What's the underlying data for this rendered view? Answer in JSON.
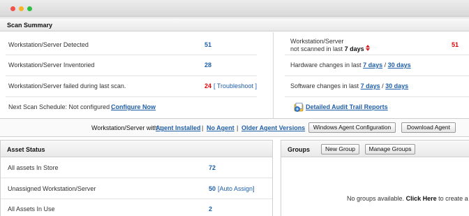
{
  "scan_summary": {
    "title": "Scan Summary",
    "left_rows": [
      {
        "label": "Workstation/Server Detected",
        "value": "51"
      },
      {
        "label": "Workstation/Server Inventoried",
        "value": "28"
      },
      {
        "label": "Workstation/Server failed during last scan.",
        "value": "24",
        "action": "[ Troubleshoot ]"
      }
    ],
    "schedule_label": "Next Scan Schedule: Not configured ,",
    "schedule_link": "Configure Now",
    "not_scanned_line1": "Workstation/Server",
    "not_scanned_line2": "not scanned in last",
    "not_scanned_period": "7 days",
    "not_scanned_value": "51",
    "hardware_label": "Hardware changes in last",
    "software_label": "Software changes in last",
    "period_7": "7 days",
    "separator": "/",
    "period_30": "30 days",
    "audit_link": "Detailed Audit Trail Reports",
    "icons": [
      "sort-arrows-icon",
      "report-icon"
    ]
  },
  "agent_bar": {
    "prefix": "Workstation/Server with :",
    "links": [
      "Agent Installed",
      "No Agent",
      "Older Agent Versions"
    ],
    "separator": "|",
    "config_button": "Windows Agent Configuration",
    "download_button": "Download Agent"
  },
  "asset_status": {
    "title": "Asset Status",
    "rows": [
      {
        "label": "All assets In Store",
        "value": "72"
      },
      {
        "label": "Unassigned Workstation/Server",
        "value": "50",
        "action": "[Auto Assign]"
      },
      {
        "label": "All Assets In Use",
        "value": "2"
      }
    ]
  },
  "groups": {
    "title": "Groups",
    "new_button": "New Group",
    "manage_button": "Manage Groups",
    "empty_prefix": "No groups available.",
    "empty_link": "Click Here",
    "empty_suffix": "to create a new g"
  },
  "colors": {
    "link": "#1f5fa8",
    "alert": "#e00000"
  }
}
